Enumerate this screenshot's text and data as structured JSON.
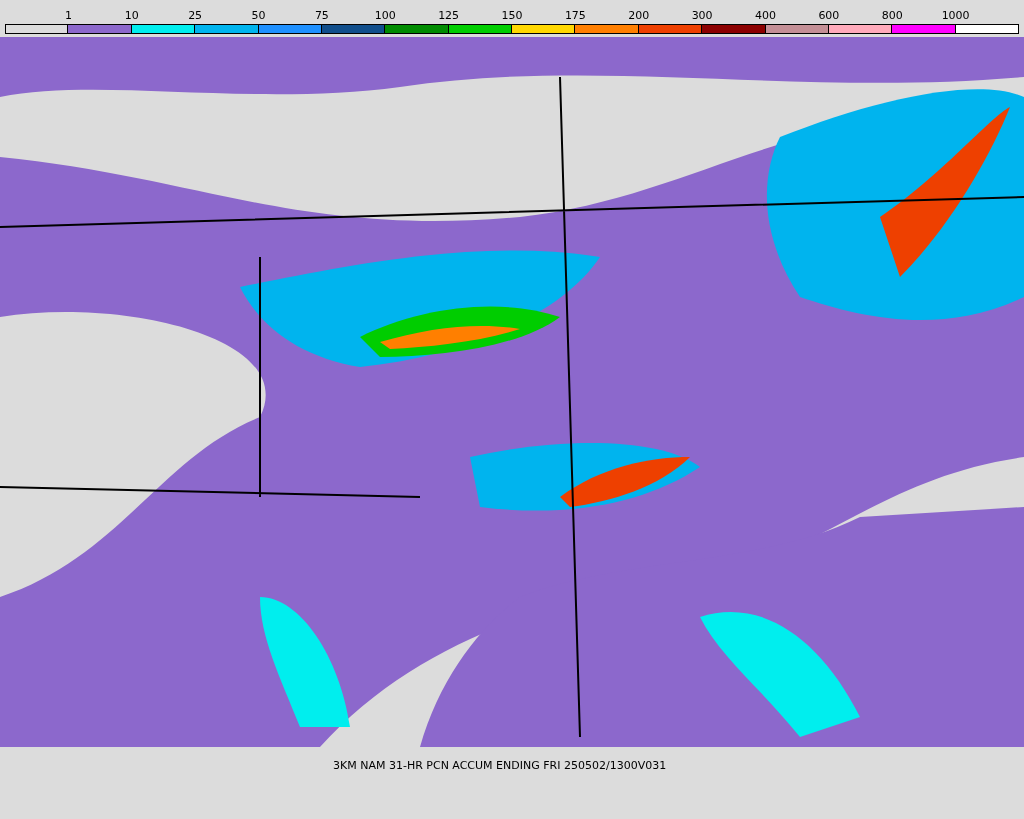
{
  "legend": [
    {
      "color": "#dcdcdc",
      "label": "1"
    },
    {
      "color": "#8c68cc",
      "label": "10"
    },
    {
      "color": "#00eeee",
      "label": "25"
    },
    {
      "color": "#00b4ee",
      "label": "50"
    },
    {
      "color": "#1e90ff",
      "label": "75"
    },
    {
      "color": "#104e8b",
      "label": "100"
    },
    {
      "color": "#008b00",
      "label": "125"
    },
    {
      "color": "#00cd00",
      "label": "150"
    },
    {
      "color": "#ffd700",
      "label": "175"
    },
    {
      "color": "#ff7f00",
      "label": "200"
    },
    {
      "color": "#ee4000",
      "label": "300"
    },
    {
      "color": "#8b0000",
      "label": "400"
    },
    {
      "color": "#c48f96",
      "label": "600"
    },
    {
      "color": "#ffaabb",
      "label": "800"
    },
    {
      "color": "#ff00ff",
      "label": "1000"
    },
    {
      "color": "#ffffff"
    }
  ],
  "caption": "3KM NAM 31-HR PCN ACCUM ENDING FRI 250502/1300V031"
}
